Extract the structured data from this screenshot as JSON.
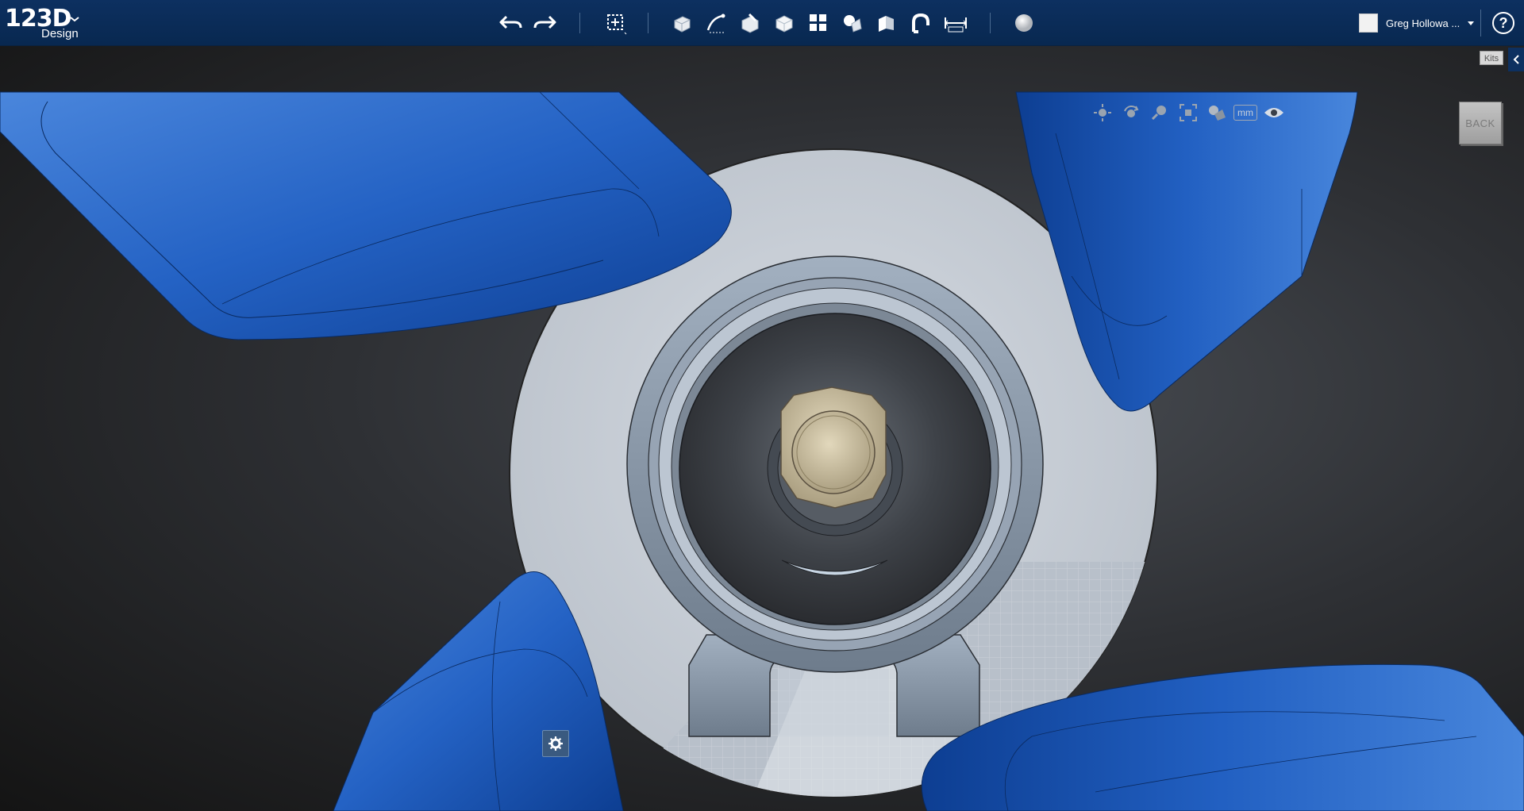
{
  "app": {
    "logo_main": "123D",
    "logo_sub": "Design"
  },
  "toolbar": {
    "tools": [
      "undo-icon",
      "redo-icon",
      "transform-icon",
      "primitives-icon",
      "sketch-icon",
      "construct-icon",
      "modify-icon",
      "pattern-icon",
      "grouping-icon",
      "combine-icon",
      "snap-icon",
      "measure-icon",
      "material-icon"
    ]
  },
  "user": {
    "name": "Greg Hollowa ...",
    "help": "?"
  },
  "viewport": {
    "units": "mm",
    "kits_label": "Kits",
    "viewcube_label": "BACK"
  },
  "colors": {
    "toolbar": "#0d3060",
    "blade": "#1f57b5",
    "disc": "#c6ccd4",
    "housing": "#8393a5",
    "shaft": "#cfc2a0"
  }
}
